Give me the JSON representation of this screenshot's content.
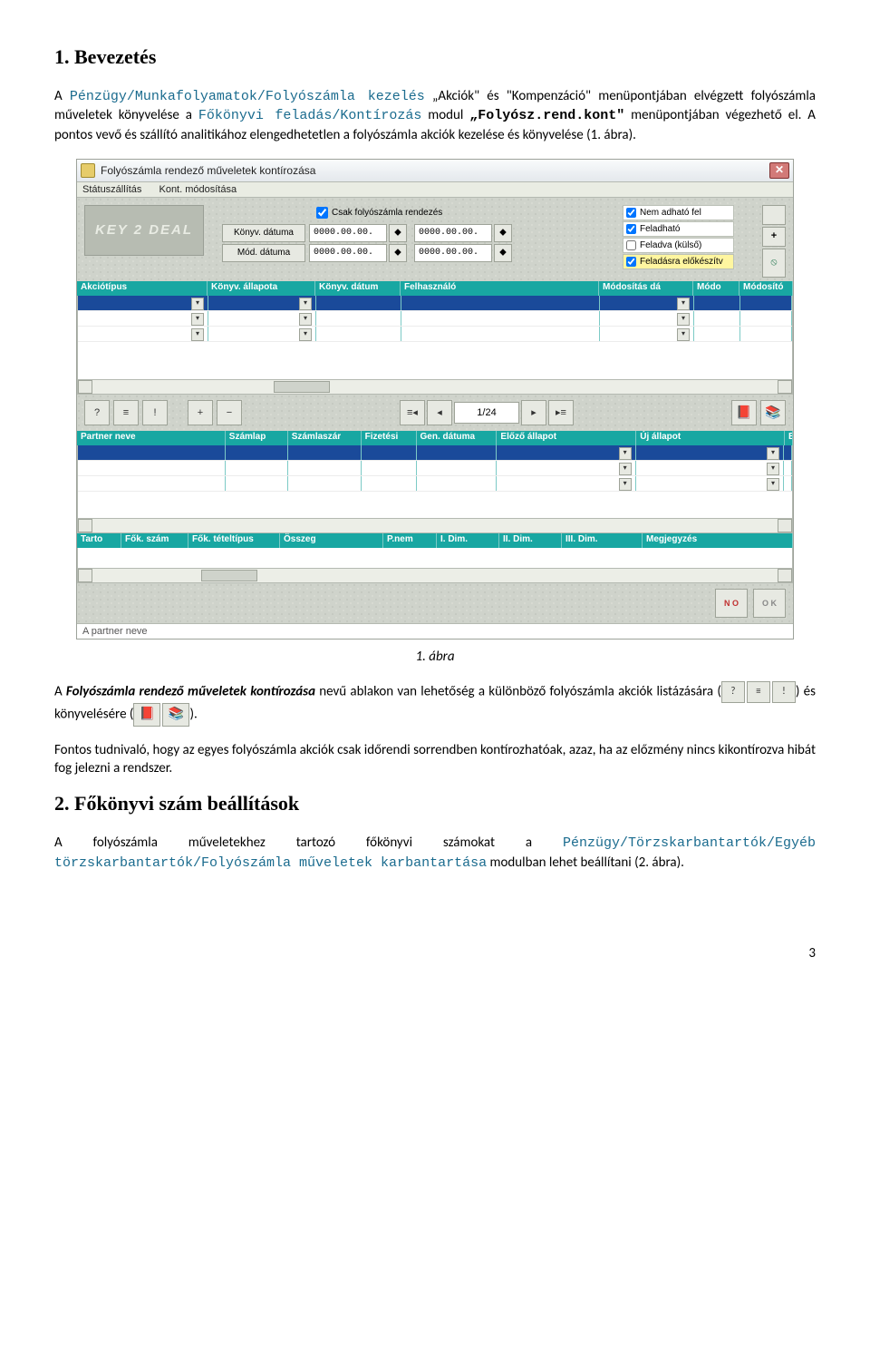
{
  "section1_title": "1. Bevezetés",
  "p1a": "A ",
  "p1_mono1": "Pénzügy/Munkafolyamatok/Folyószámla kezelés",
  "p1b": " „Akciók\" és \"Kompenzáció\" menüpontjában elvégzett folyószámla műveletek könyvelése a ",
  "p1_mono2": "Főkönyvi feladás/Kontírozás",
  "p1c": " modul ",
  "p1_mono3": "„Folyósz.rend.kont\"",
  "p1d": " menüpontjában végezhető el. A pontos vevő és szállító analitikához elengedhetetlen a folyószámla akciók kezelése és könyvelése (1. ábra).",
  "caption1": "1. ábra",
  "p2a": "A ",
  "p2bi": "Folyószámla rendező műveletek kontírozása",
  "p2b": " nevű ablakon van lehetőség a különböző folyószámla akciók listázására (",
  "p2c": ") és könyvelésére (",
  "p2d": ").",
  "p3": "Fontos tudnivaló, hogy az egyes folyószámla akciók csak időrendi sorrendben kontírozhatóak, azaz, ha az előzmény nincs kikontírozva hibát fog jelezni a rendszer.",
  "section2_title": "2. Főkönyvi szám beállítások",
  "p4a": "A folyószámla műveletekhez tartozó főkönyvi számokat a ",
  "p4_mono1": "Pénzügy/Törzskarbantartók/Egyéb törzskarbantartók/Folyószámla műveletek karbantartása",
  "p4b": " modulban lehet beállítani (2. ábra).",
  "page": "3",
  "win": {
    "title": "Folyószámla rendező műveletek kontírozása",
    "menu1": "Státuszállítás",
    "menu2": "Kont. módosítása",
    "status": "A partner neve",
    "logo": "KEY 2 DEAL",
    "csak_chk": "Csak folyószámla rendezés",
    "date1_label": "Könyv. dátuma",
    "date2_label": "Mód. dátuma",
    "datev": "0000.00.00.",
    "opt1": "Nem adható fel",
    "opt2": "Feladható",
    "opt3": "Feladva (külső)",
    "opt4": "Feladásra előkészítv",
    "grid1": [
      "Akciótípus",
      "Könyv. állapota",
      "Könyv. dátum",
      "Felhasználó",
      "Módosítás dá",
      "Módo",
      "Módosító"
    ],
    "grid2": [
      "Partner neve",
      "Számlap",
      "Számlaszár",
      "Fizetési",
      "Gen. dátuma",
      "Előző állapot",
      "Új állapot",
      "B. k"
    ],
    "grid3": [
      "Tarto",
      "Fők. szám",
      "Fők. tételtípus",
      "Összeg",
      "P.nem",
      "I. Dim.",
      "II. Dim.",
      "III. Dim.",
      "Megjegyzés"
    ],
    "pager": "1/24",
    "no": "N O",
    "ok": "O K"
  }
}
